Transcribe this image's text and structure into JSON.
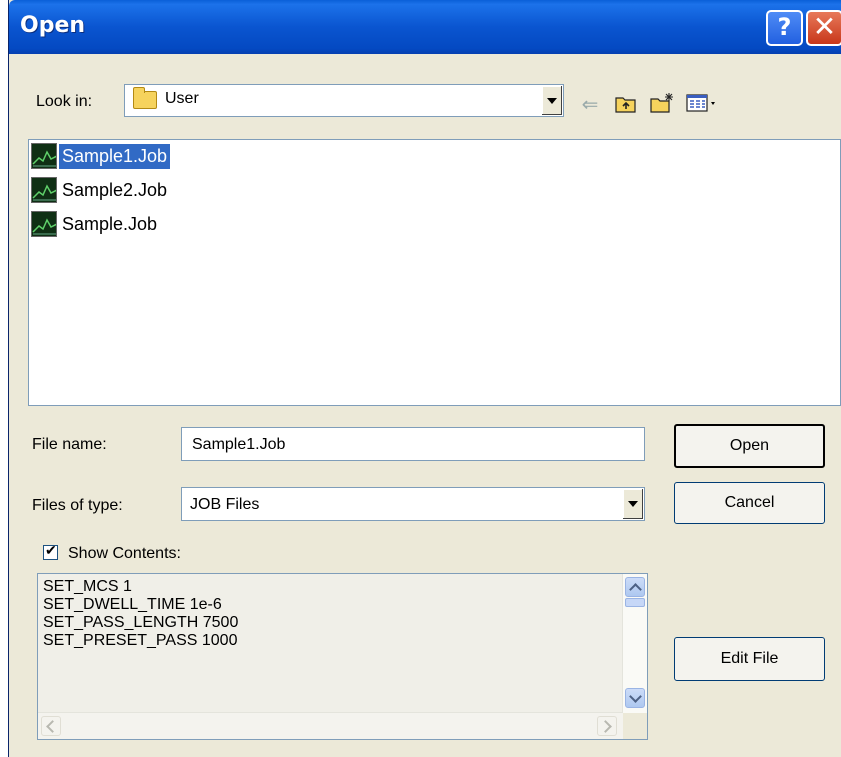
{
  "window": {
    "title": "Open",
    "help_glyph": "?",
    "close_glyph": "✕"
  },
  "lookin": {
    "label": "Look in:",
    "value": "User"
  },
  "toolbar": {
    "icons": [
      "back-arrow-icon",
      "up-folder-icon",
      "new-folder-icon",
      "view-menu-icon"
    ]
  },
  "files": [
    {
      "name": "Sample1.Job",
      "selected": true
    },
    {
      "name": "Sample2.Job",
      "selected": false
    },
    {
      "name": "Sample.Job",
      "selected": false
    }
  ],
  "filename": {
    "label": "File name:",
    "value": "Sample1.Job"
  },
  "filetype": {
    "label": "Files of type:",
    "value": "JOB Files"
  },
  "buttons": {
    "open": "Open",
    "cancel": "Cancel",
    "edit_file": "Edit File"
  },
  "show_contents": {
    "label": "Show Contents:",
    "checked": true
  },
  "contents_lines": [
    "SET_MCS 1",
    "SET_DWELL_TIME 1e-6",
    "SET_PASS_LENGTH 7500",
    "SET_PRESET_PASS 1000"
  ],
  "colors": {
    "titlebar": "#0a55d0",
    "selection": "#316ac5",
    "dialog_bg": "#ece9d8"
  }
}
